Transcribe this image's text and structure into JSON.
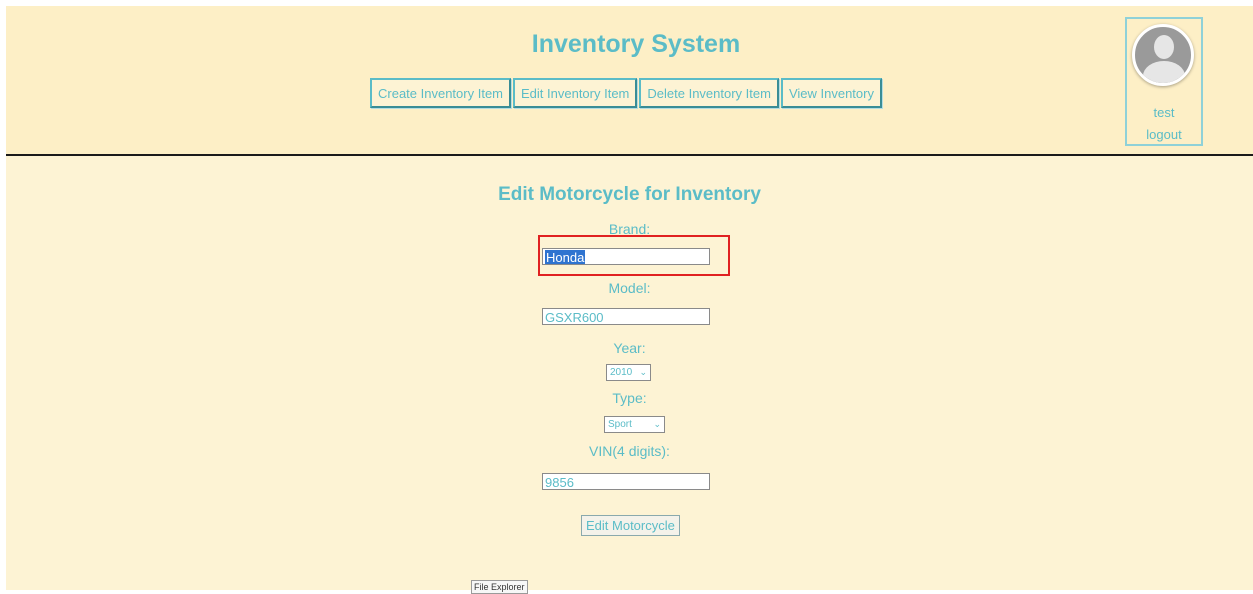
{
  "header": {
    "title": "Inventory System",
    "nav": [
      {
        "label": "Create Inventory Item"
      },
      {
        "label": "Edit Inventory Item"
      },
      {
        "label": "Delete Inventory Item"
      },
      {
        "label": "View Inventory"
      }
    ]
  },
  "user": {
    "avatar_icon": "user-avatar-icon",
    "name": "test",
    "logout_label": "logout"
  },
  "form": {
    "title": "Edit Motorcycle for Inventory",
    "brand": {
      "label": "Brand:",
      "value": "Honda"
    },
    "model": {
      "label": "Model:",
      "value": "GSXR600"
    },
    "year": {
      "label": "Year:",
      "value": "2010"
    },
    "type": {
      "label": "Type:",
      "value": "Sport"
    },
    "vin": {
      "label": "VIN(4 digits):",
      "value": "9856"
    },
    "submit_label": "Edit Motorcycle"
  },
  "tooltip": {
    "text": "File Explorer"
  },
  "colors": {
    "accent": "#5bbcc7",
    "background": "#fdf3d4",
    "header_background": "#fdefc6",
    "highlight": "#e02121",
    "selection": "#2f74d0"
  }
}
